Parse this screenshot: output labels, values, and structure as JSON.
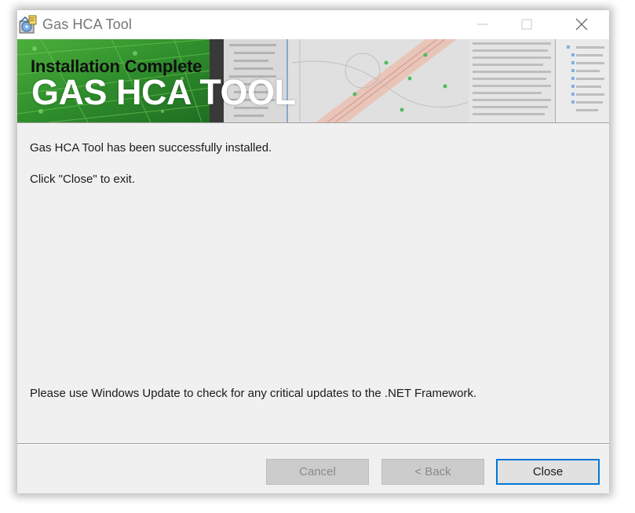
{
  "window": {
    "title": "Gas HCA Tool"
  },
  "banner": {
    "heading": "Installation Complete",
    "product": "GAS HCA TOOL"
  },
  "content": {
    "message_installed": "Gas HCA Tool has been successfully installed.",
    "message_close": "Click \"Close\" to exit.",
    "message_update": "Please use Windows Update to check for any critical updates to the .NET Framework."
  },
  "buttons": {
    "cancel": "Cancel",
    "back": "< Back",
    "close": "Close"
  },
  "colors": {
    "accent": "#0078d7",
    "banner_green": "#3aa336",
    "dialog_bg": "#f0f0f0"
  },
  "icons": {
    "app": "installer-disc-icon",
    "minimize": "minimize-icon",
    "maximize": "maximize-icon",
    "close": "close-icon"
  }
}
